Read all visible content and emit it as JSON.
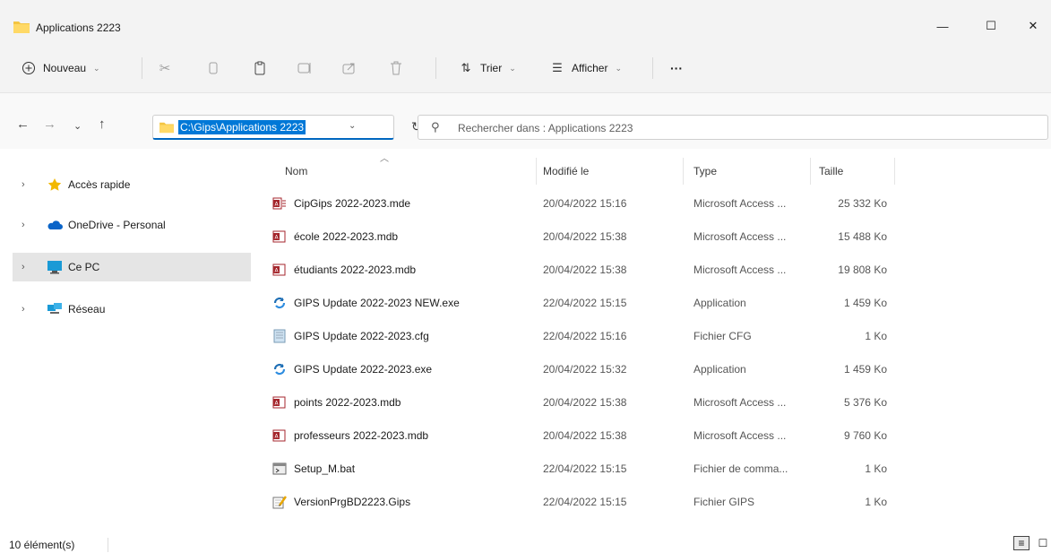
{
  "window": {
    "title": "Applications 2223",
    "minimize_glyph": "—",
    "maximize_glyph": "☐",
    "close_glyph": "✕"
  },
  "toolbar": {
    "new_label": "Nouveau",
    "sort_label": "Trier",
    "view_label": "Afficher",
    "more_label": "···"
  },
  "address": {
    "path": "C:\\Gips\\Applications 2223",
    "search_placeholder": "Rechercher dans : Applications 2223"
  },
  "sidebar": {
    "items": [
      {
        "label": "Accès rapide",
        "icon": "star-icon"
      },
      {
        "label": "OneDrive - Personal",
        "icon": "cloud-icon"
      },
      {
        "label": "Ce PC",
        "icon": "monitor-icon"
      },
      {
        "label": "Réseau",
        "icon": "network-icon"
      }
    ]
  },
  "columns": {
    "name": "Nom",
    "modified": "Modifié le",
    "type": "Type",
    "size": "Taille"
  },
  "files": [
    {
      "name": "CipGips 2022-2023.mde",
      "modified": "20/04/2022 15:16",
      "type": "Microsoft Access ...",
      "size": "25 332 Ko",
      "icon": "access-icon"
    },
    {
      "name": "école 2022-2023.mdb",
      "modified": "20/04/2022 15:38",
      "type": "Microsoft Access ...",
      "size": "15 488 Ko",
      "icon": "access-icon"
    },
    {
      "name": "étudiants 2022-2023.mdb",
      "modified": "20/04/2022 15:38",
      "type": "Microsoft Access ...",
      "size": "19 808 Ko",
      "icon": "access-icon"
    },
    {
      "name": "GIPS Update 2022-2023 NEW.exe",
      "modified": "22/04/2022 15:15",
      "type": "Application",
      "size": "1 459 Ko",
      "icon": "update-icon"
    },
    {
      "name": "GIPS Update 2022-2023.cfg",
      "modified": "22/04/2022 15:16",
      "type": "Fichier CFG",
      "size": "1 Ko",
      "icon": "cfg-file-icon"
    },
    {
      "name": "GIPS Update 2022-2023.exe",
      "modified": "20/04/2022 15:32",
      "type": "Application",
      "size": "1 459 Ko",
      "icon": "update-icon"
    },
    {
      "name": "points 2022-2023.mdb",
      "modified": "20/04/2022 15:38",
      "type": "Microsoft Access ...",
      "size": "5 376 Ko",
      "icon": "access-icon"
    },
    {
      "name": "professeurs 2022-2023.mdb",
      "modified": "20/04/2022 15:38",
      "type": "Microsoft Access ...",
      "size": "9 760 Ko",
      "icon": "access-icon"
    },
    {
      "name": "Setup_M.bat",
      "modified": "22/04/2022 15:15",
      "type": "Fichier de comma...",
      "size": "1 Ko",
      "icon": "batch-file-icon"
    },
    {
      "name": "VersionPrgBD2223.Gips",
      "modified": "22/04/2022 15:15",
      "type": "Fichier GIPS",
      "size": "1 Ko",
      "icon": "gips-file-icon"
    }
  ],
  "status": {
    "count": "10 élément(s)"
  }
}
